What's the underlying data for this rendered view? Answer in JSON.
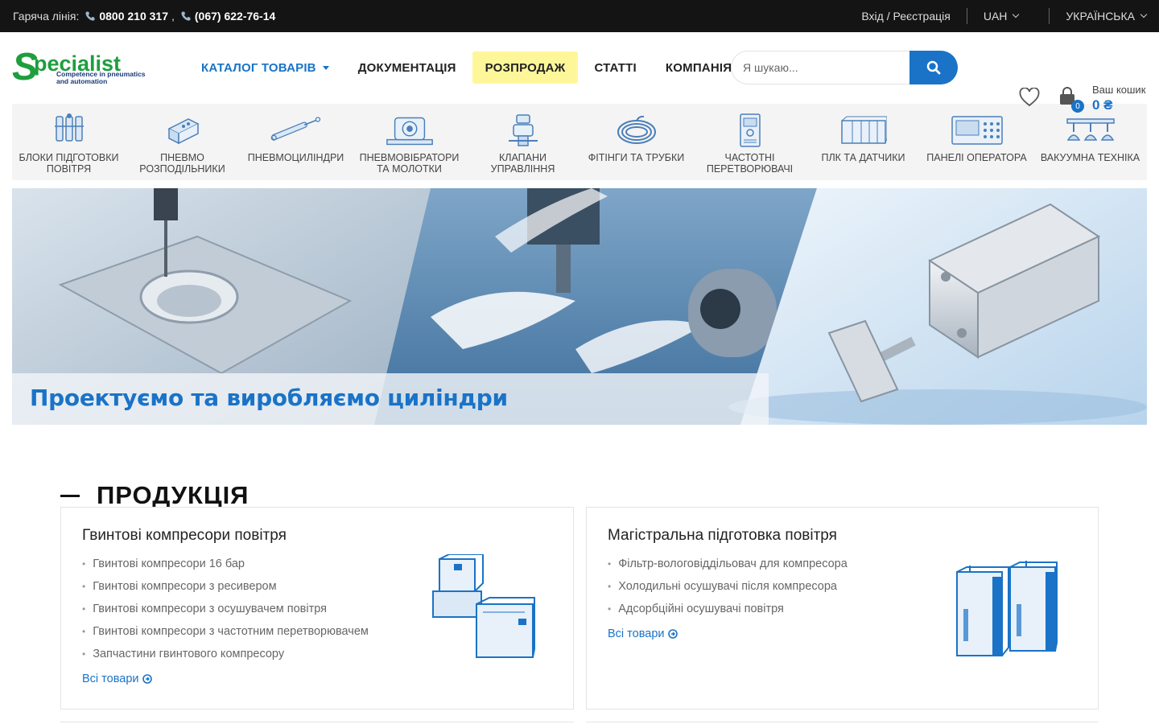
{
  "topbar": {
    "hotline_label": "Гаряча лінія:",
    "phone1": "0800 210 317",
    "comma": ",",
    "phone2": "(067) 622-76-14",
    "login": "Вхід / Реєстрація",
    "currency": "UAH",
    "language": "УКРАЇНСЬКА"
  },
  "logo": {
    "brand": "Specialist",
    "tagline_1": "Competence in pneumatics",
    "tagline_2": "and automation"
  },
  "nav": {
    "catalog": "КАТАЛОГ ТОВАРІВ",
    "docs": "ДОКУМЕНТАЦІЯ",
    "sale": "РОЗПРОДАЖ",
    "articles": "СТАТТІ",
    "company": "КОМПАНІЯ"
  },
  "search": {
    "placeholder": "Я шукаю..."
  },
  "cart": {
    "label": "Ваш кошик",
    "total": "0 ₴",
    "count": "0"
  },
  "categories": [
    {
      "label": "БЛОКИ ПІДГОТОВКИ ПОВІТРЯ",
      "icon": "frl-unit-icon"
    },
    {
      "label": "ПНЕВМО РОЗПОДІЛЬНИКИ",
      "icon": "valve-manifold-icon"
    },
    {
      "label": "ПНЕВМОЦИЛІНДРИ",
      "icon": "cylinder-icon"
    },
    {
      "label": "ПНЕВМОВІБРАТОРИ ТА МОЛОТКИ",
      "icon": "vibrator-icon"
    },
    {
      "label": "КЛАПАНИ УПРАВЛІННЯ",
      "icon": "control-valve-icon"
    },
    {
      "label": "ФІТІНГИ ТА ТРУБКИ",
      "icon": "tubing-icon"
    },
    {
      "label": "ЧАСТОТНІ ПЕРЕТВОРЮВАЧІ",
      "icon": "inverter-icon"
    },
    {
      "label": "ПЛК ТА ДАТЧИКИ",
      "icon": "plc-icon"
    },
    {
      "label": "ПАНЕЛІ ОПЕРАТОРА",
      "icon": "hmi-panel-icon"
    },
    {
      "label": "ВАКУУМНА ТЕХНІКА",
      "icon": "vacuum-icon"
    }
  ],
  "banner": {
    "caption": "Проектуємо та виробляємо циліндри"
  },
  "products": {
    "title": "ПРОДУКЦІЯ",
    "cards": [
      {
        "title": "Гвинтові компресори повітря",
        "items": [
          "Гвинтові компресори 16 бар",
          "Гвинтові компресори з ресивером",
          "Гвинтові компресори з осушувачем повітря",
          "Гвинтові компресори з частотним перетворювачем",
          "Запчастини гвинтового компресору"
        ],
        "all_link": "Всі товари"
      },
      {
        "title": "Магістральна підготовка повітря",
        "items": [
          "Фільтр-вологовіддільовач для компресора",
          "Холодильні осушувачі після компресора",
          "Адсорбційні осушувачі повітря"
        ],
        "all_link": "Всі товари"
      }
    ]
  },
  "colors": {
    "accent": "#1a73c7",
    "sale_bg": "#fdf79a",
    "topbar_bg": "#141414",
    "logo_green": "#1e9e3c"
  }
}
